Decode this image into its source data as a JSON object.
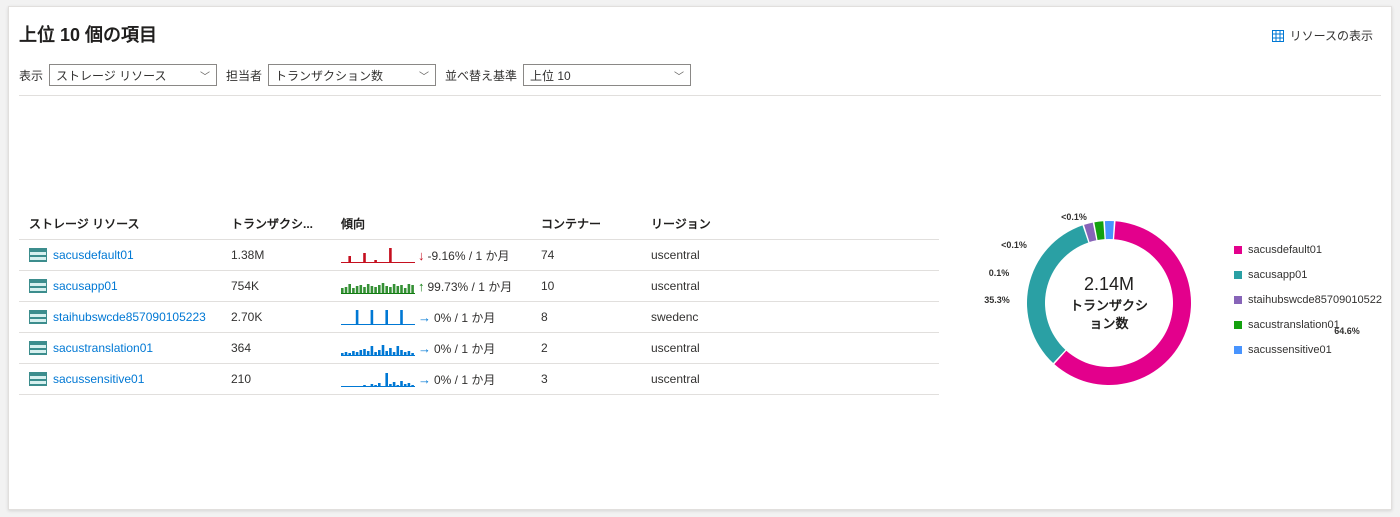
{
  "header": {
    "title": "上位 10 個の項目",
    "view_resources": "リソースの表示"
  },
  "filters": {
    "display_label": "表示",
    "display_value": "ストレージ リソース",
    "assignee_label": "担当者",
    "assignee_value": "トランザクション数",
    "sort_label": "並べ替え基準",
    "sort_value": "上位 10"
  },
  "table": {
    "columns": [
      "ストレージ リソース",
      "トランザクシ...",
      "傾向",
      "コンテナー",
      "リージョン"
    ],
    "rows": [
      {
        "name": "sacusdefault01",
        "transactions": "1.38M",
        "arrow": "↓",
        "trend": "-9.16% / 1 か月",
        "containers": "74",
        "region": "uscentral",
        "color": "#c50f1f"
      },
      {
        "name": "sacusapp01",
        "transactions": "754K",
        "arrow": "↑",
        "trend": "99.73% / 1 か月",
        "containers": "10",
        "region": "uscentral",
        "color": "#107c10"
      },
      {
        "name": "staihubswcde857090105223",
        "transactions": "2.70K",
        "arrow": "→",
        "trend": "0% / 1 か月",
        "containers": "8",
        "region": "swedenc",
        "color": "#0078d4"
      },
      {
        "name": "sacustranslation01",
        "transactions": "364",
        "arrow": "→",
        "trend": "0% / 1 か月",
        "containers": "2",
        "region": "uscentral",
        "color": "#0078d4"
      },
      {
        "name": "sacussensitive01",
        "transactions": "210",
        "arrow": "→",
        "trend": "0% / 1 か月",
        "containers": "3",
        "region": "uscentral",
        "color": "#0078d4"
      }
    ]
  },
  "chart_data": {
    "type": "pie",
    "center_value": "2.14M",
    "center_label_line1": "トランザクシ",
    "center_label_line2": "ョン数",
    "slices": [
      {
        "name": "sacusdefault01",
        "value": 64.6,
        "label": "64.6%",
        "color": "#e3008c"
      },
      {
        "name": "sacusapp01",
        "value": 35.3,
        "label": "35.3%",
        "color": "#2aa0a4"
      },
      {
        "name": "staihubswcde85709010522",
        "value": 0.1,
        "label": "0.1%",
        "color": "#8764b8"
      },
      {
        "name": "sacustranslation01",
        "value": 0.05,
        "label": "<0.1%",
        "color": "#13a10e"
      },
      {
        "name": "sacussensitive01",
        "value": 0.05,
        "label": "<0.1%",
        "color": "#4894fe"
      }
    ]
  }
}
